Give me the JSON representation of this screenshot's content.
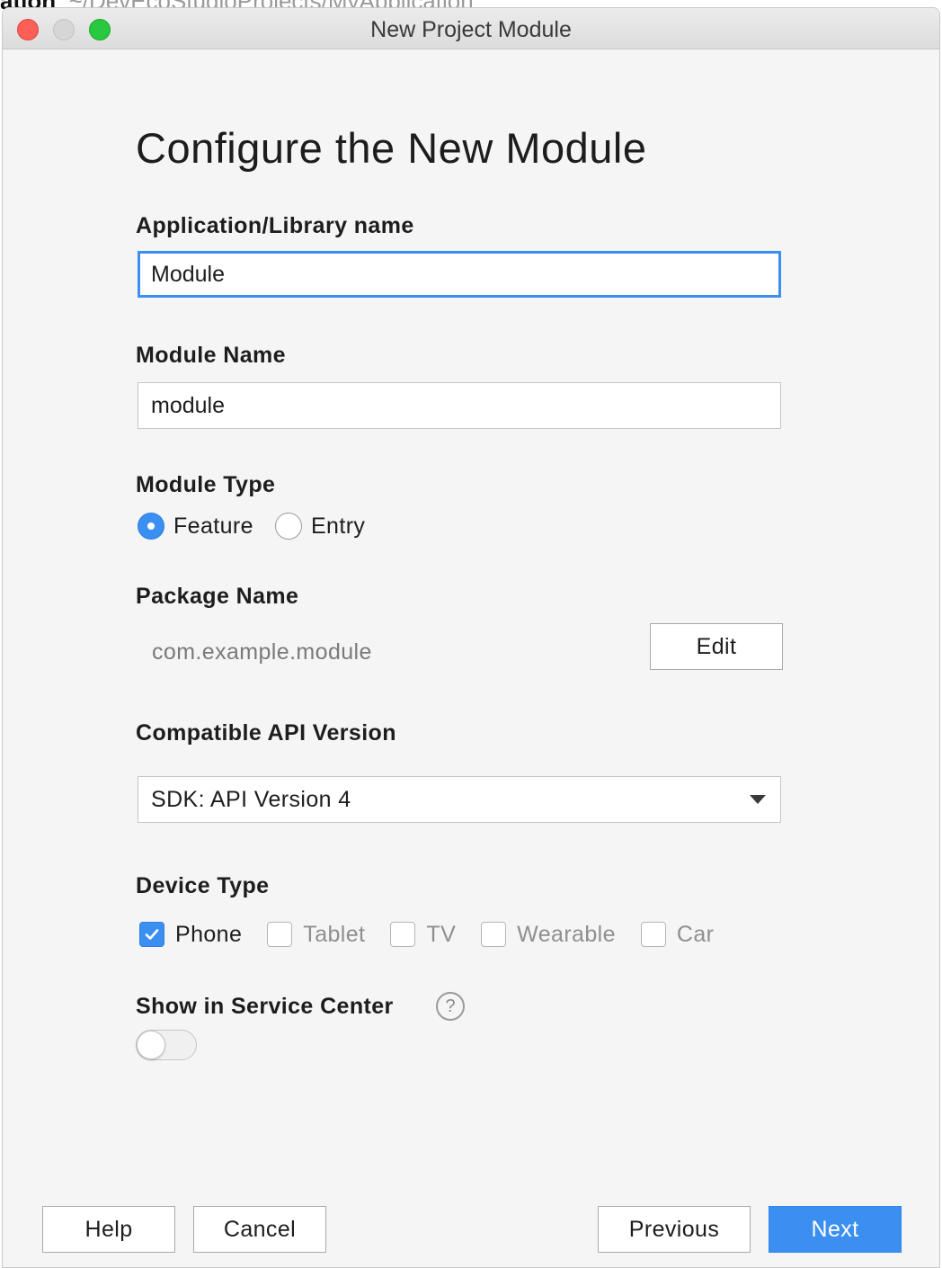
{
  "background": {
    "partial_text_bold": "ation",
    "partial_text": "~/DevEcoStudioProjects/MyApplication"
  },
  "window": {
    "title": "New Project Module"
  },
  "colors": {
    "accent": "#3b8ff0",
    "close": "#fe5f57",
    "maximize": "#28c840"
  },
  "form": {
    "heading": "Configure the New Module",
    "app_name": {
      "label": "Application/Library name",
      "value": "Module"
    },
    "module_name": {
      "label": "Module Name",
      "value": "module"
    },
    "module_type": {
      "label": "Module Type",
      "options": [
        {
          "label": "Feature",
          "selected": true
        },
        {
          "label": "Entry",
          "selected": false
        }
      ]
    },
    "package": {
      "label": "Package Name",
      "value": "com.example.module",
      "edit_label": "Edit"
    },
    "api": {
      "label": "Compatible API Version",
      "selected": "SDK: API Version 4"
    },
    "device_type": {
      "label": "Device Type",
      "options": [
        {
          "label": "Phone",
          "checked": true
        },
        {
          "label": "Tablet",
          "checked": false
        },
        {
          "label": "TV",
          "checked": false
        },
        {
          "label": "Wearable",
          "checked": false
        },
        {
          "label": "Car",
          "checked": false
        }
      ]
    },
    "service_center": {
      "label": "Show in Service Center",
      "help_glyph": "?",
      "enabled": false
    }
  },
  "footer": {
    "help": "Help",
    "cancel": "Cancel",
    "previous": "Previous",
    "next": "Next"
  }
}
